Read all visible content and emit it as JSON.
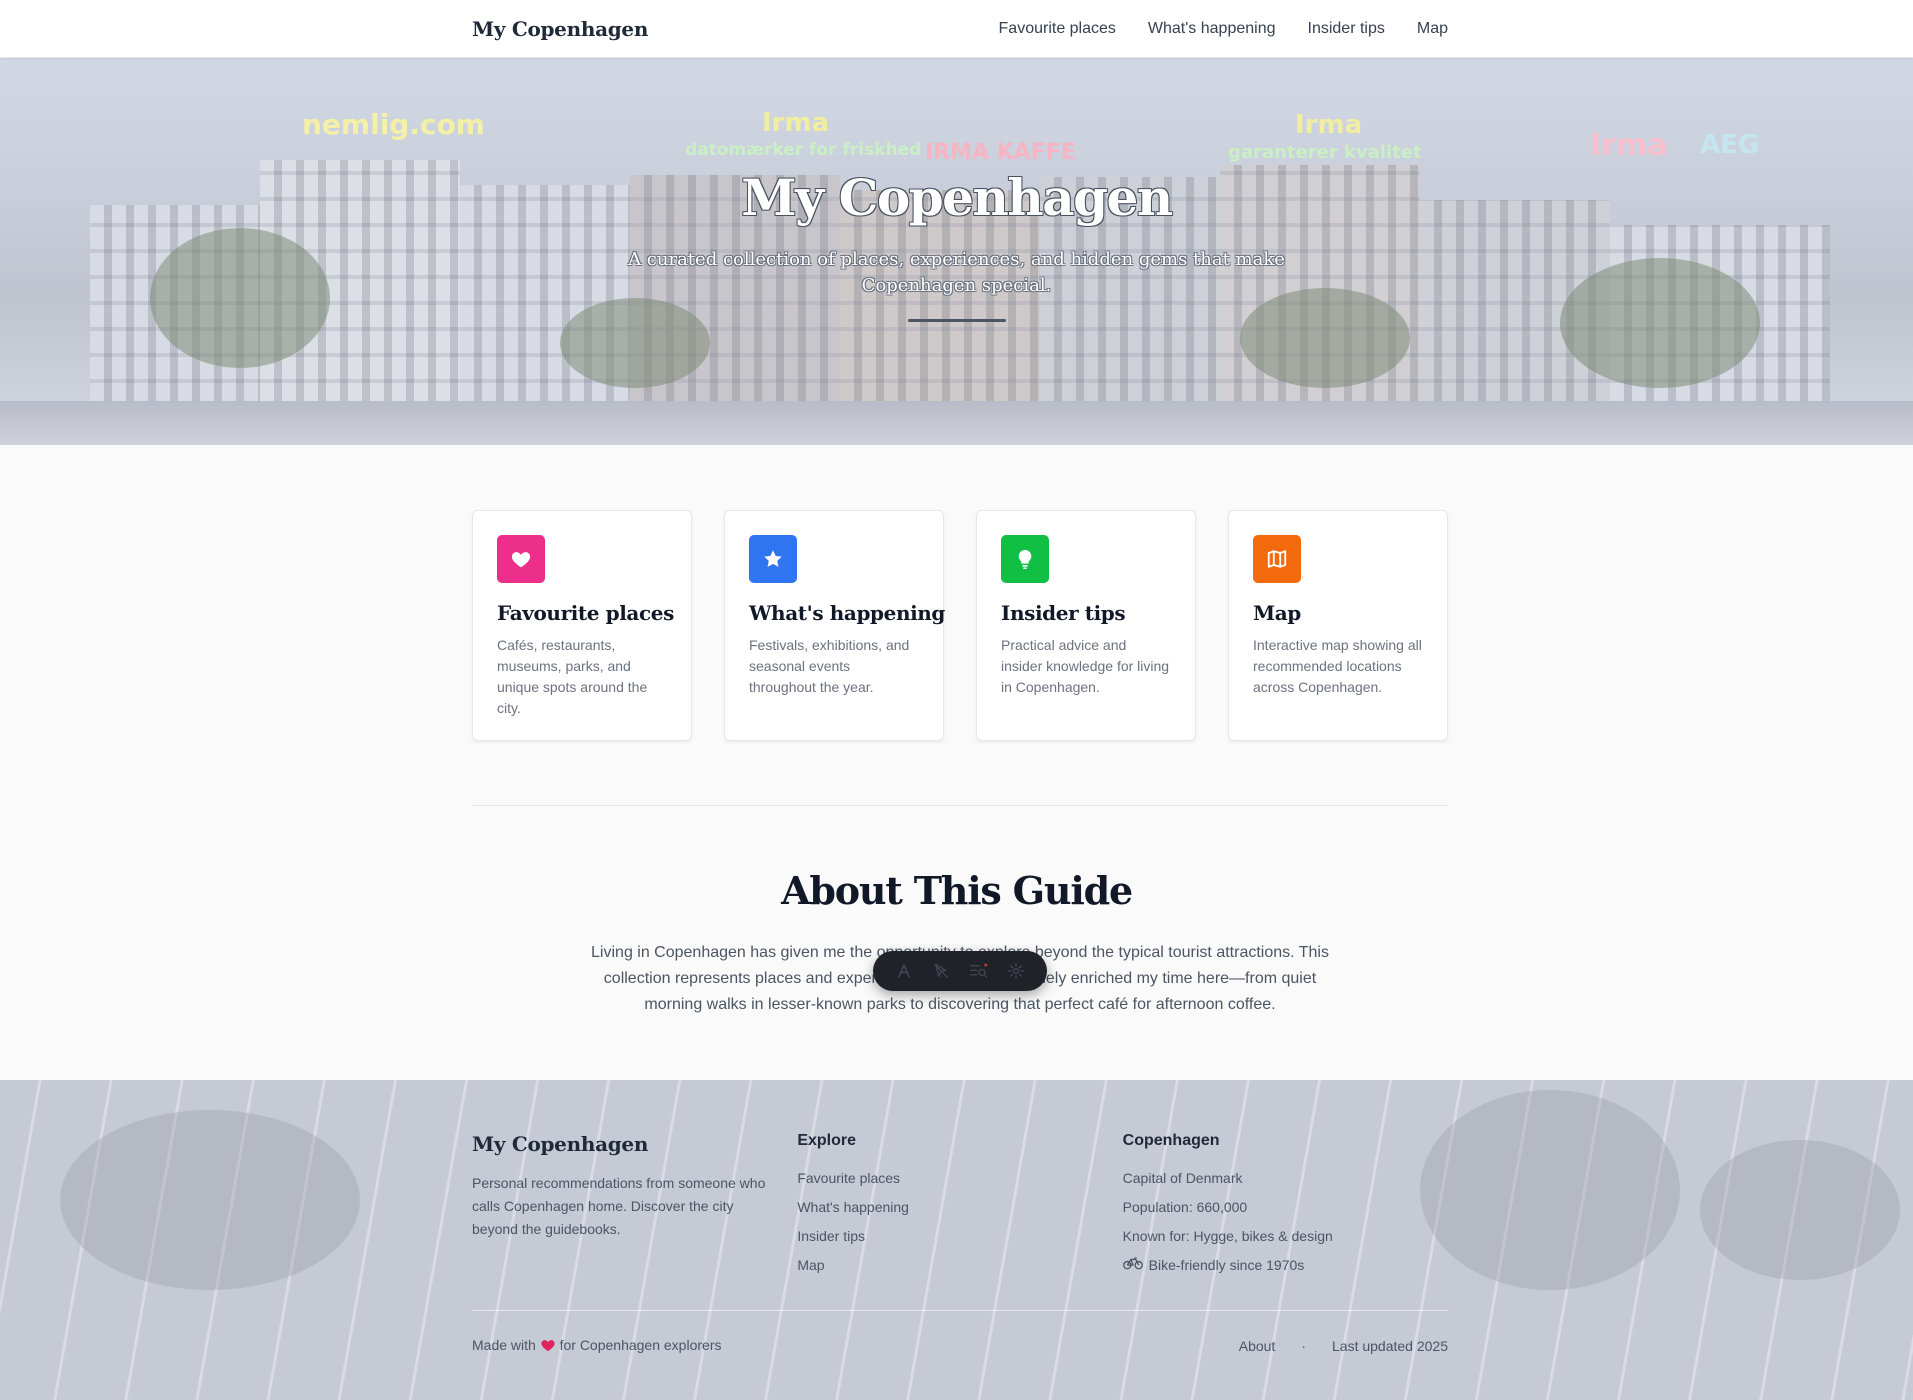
{
  "nav": {
    "brand": "My Copenhagen",
    "links": [
      "Favourite places",
      "What's happening",
      "Insider tips",
      "Map"
    ]
  },
  "hero": {
    "title": "My Copenhagen",
    "subtitle": "A curated collection of places, experiences, and hidden gems that make Copenhagen special."
  },
  "cards": [
    {
      "title": "Favourite places",
      "desc": "Cafés, restaurants, museums, parks, and unique spots around the city.",
      "icon": "heart-icon",
      "color": "#ec2f8b"
    },
    {
      "title": "What's happening",
      "desc": "Festivals, exhibitions, and seasonal events throughout the year.",
      "icon": "star-icon",
      "color": "#2f74f0"
    },
    {
      "title": "Insider tips",
      "desc": "Practical advice and insider knowledge for living in Copenhagen.",
      "icon": "lightbulb-icon",
      "color": "#12bf45"
    },
    {
      "title": "Map",
      "desc": "Interactive map showing all recommended locations across Copenhagen.",
      "icon": "map-icon",
      "color": "#f26a0b"
    }
  ],
  "about": {
    "title": "About This Guide",
    "text": "Living in Copenhagen has given me the opportunity to explore beyond the typical tourist attractions. This collection represents places and experiences that have genuinely enriched my time here—from quiet morning walks in lesser-known parks to discovering that perfect café for afternoon coffee."
  },
  "toolbar": {
    "icons": [
      "font-icon",
      "cursor-icon",
      "list-search-icon",
      "gear-icon"
    ]
  },
  "footer": {
    "brand": "My Copenhagen",
    "desc": "Personal recommendations from someone who calls Copenhagen home. Discover the city beyond the guidebooks.",
    "explore_heading": "Explore",
    "explore_links": [
      "Favourite places",
      "What's happening",
      "Insider tips",
      "Map"
    ],
    "city_heading": "Copenhagen",
    "city_facts": [
      "Capital of Denmark",
      "Population: 660,000",
      "Known for: Hygge, bikes & design",
      "Bike-friendly since 1970s"
    ],
    "made_with_prefix": "Made with",
    "made_with_suffix": "for Copenhagen explorers",
    "about_link": "About",
    "separator": "·",
    "updated": "Last updated 2025"
  }
}
